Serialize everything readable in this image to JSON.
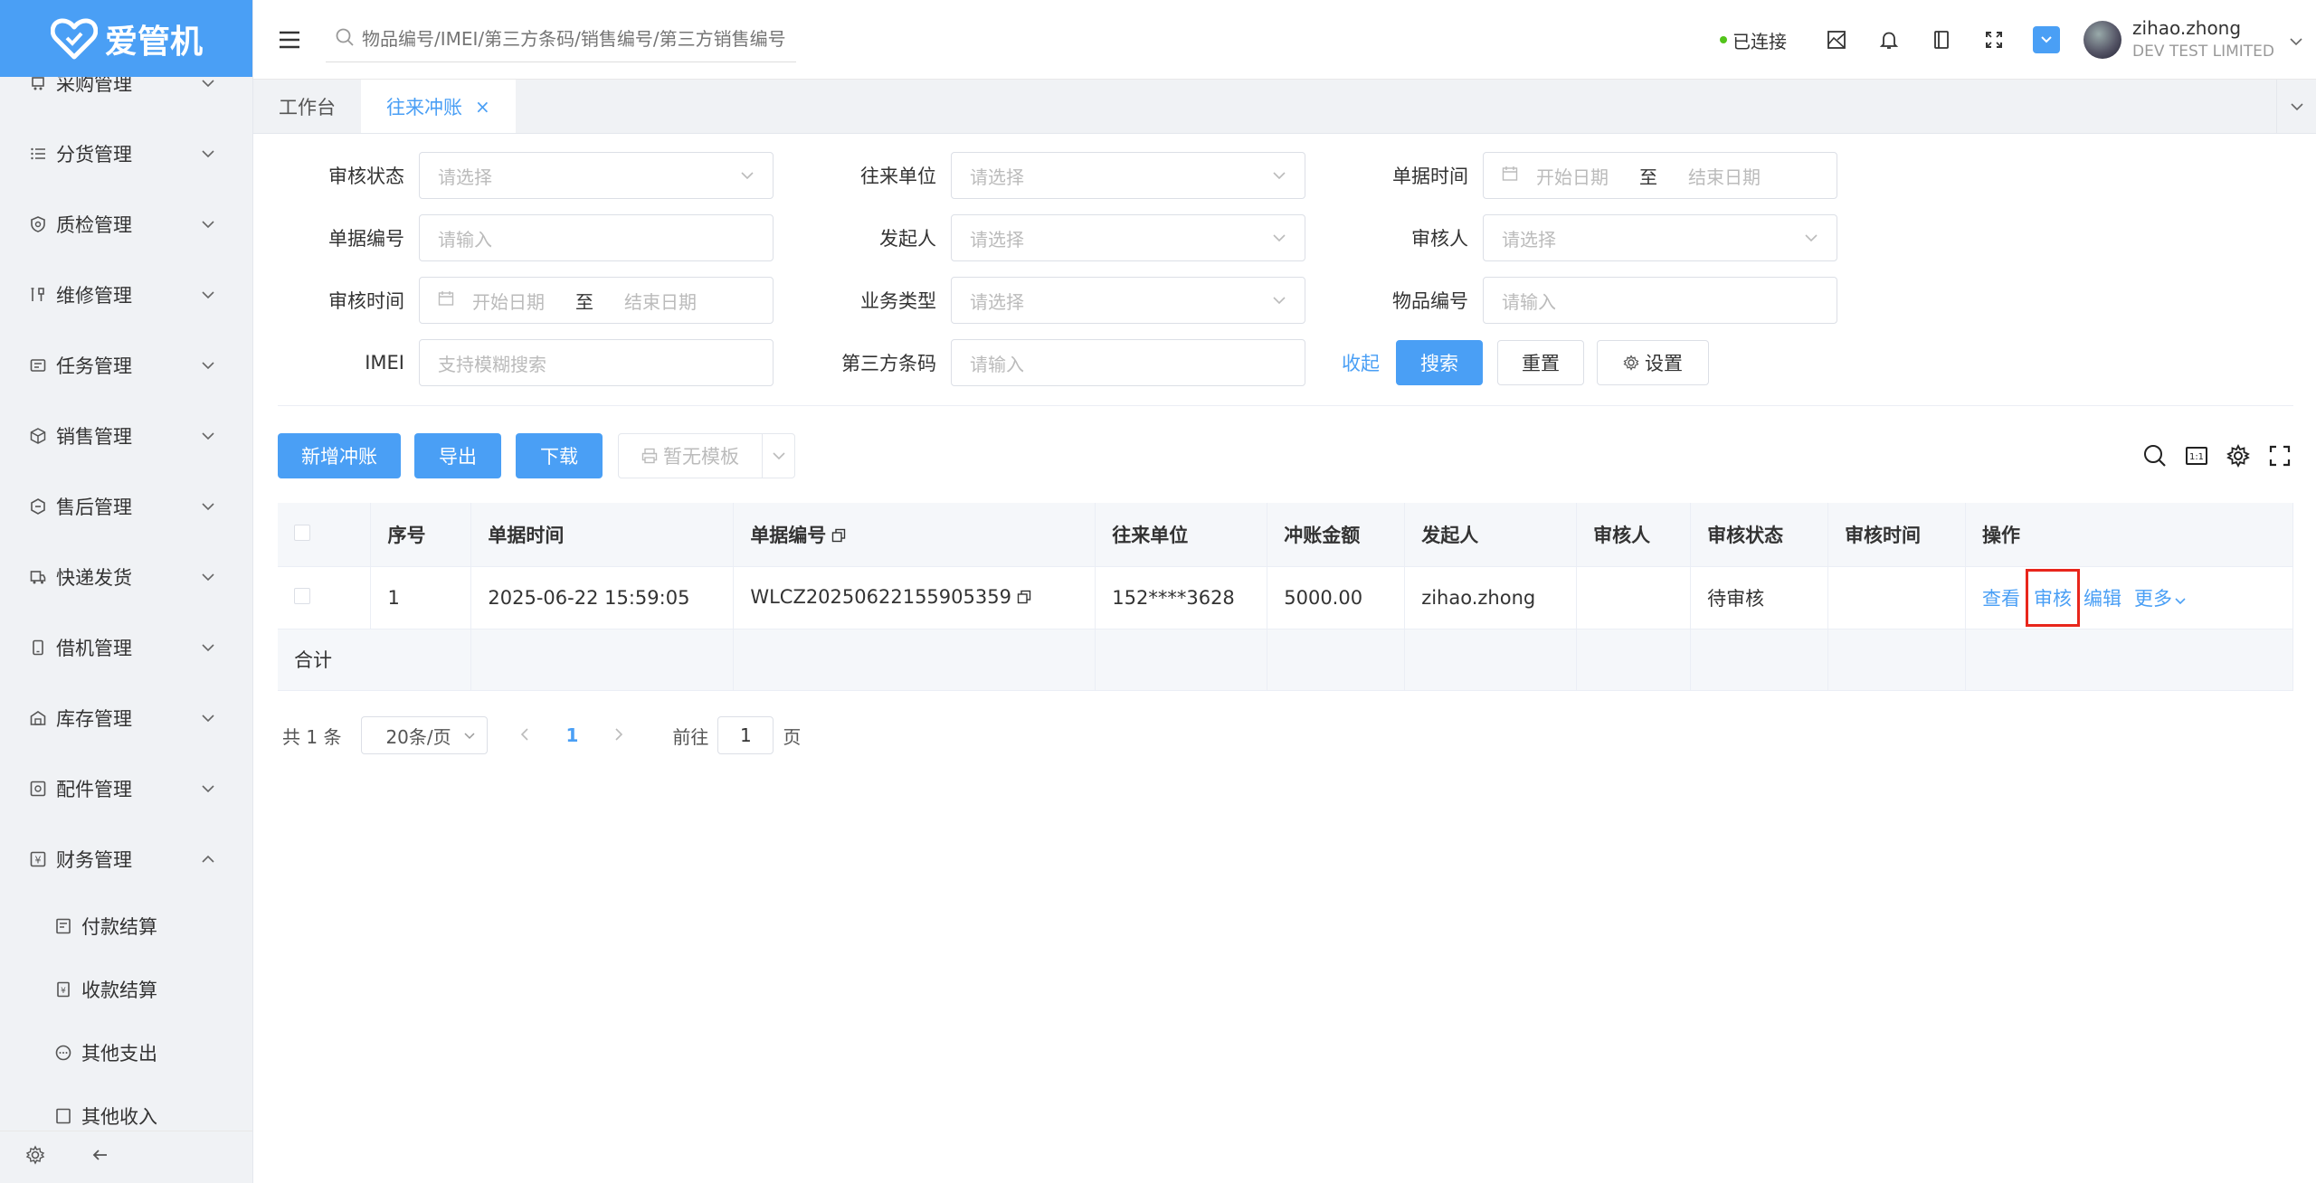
{
  "app": {
    "logo_text": "爱管机"
  },
  "sidebar": {
    "items": [
      {
        "label": "采购管理",
        "icon": "cart-icon"
      },
      {
        "label": "分货管理",
        "icon": "list-icon"
      },
      {
        "label": "质检管理",
        "icon": "shield-check-icon"
      },
      {
        "label": "维修管理",
        "icon": "tools-icon"
      },
      {
        "label": "任务管理",
        "icon": "task-icon"
      },
      {
        "label": "销售管理",
        "icon": "box-icon"
      },
      {
        "label": "售后管理",
        "icon": "service-icon"
      },
      {
        "label": "快递发货",
        "icon": "truck-icon"
      },
      {
        "label": "借机管理",
        "icon": "phone-icon"
      },
      {
        "label": "库存管理",
        "icon": "warehouse-icon"
      },
      {
        "label": "配件管理",
        "icon": "parts-icon"
      },
      {
        "label": "财务管理",
        "icon": "finance-icon"
      }
    ],
    "sub_items": [
      {
        "label": "付款结算"
      },
      {
        "label": "收款结算"
      },
      {
        "label": "其他支出"
      },
      {
        "label": "其他收入"
      }
    ]
  },
  "header": {
    "search_placeholder": "物品编号/IMEI/第三方条码/销售编号/第三方销售编号",
    "status": "已连接",
    "user_name": "zihao.zhong",
    "user_company": "DEV TEST LIMITED"
  },
  "tabs": [
    {
      "label": "工作台",
      "active": false
    },
    {
      "label": "往来冲账",
      "active": true
    }
  ],
  "form": {
    "labels": {
      "audit_status": "审核状态",
      "partner": "往来单位",
      "doc_time": "单据时间",
      "doc_no": "单据编号",
      "initiator": "发起人",
      "auditor": "审核人",
      "audit_time": "审核时间",
      "biz_type": "业务类型",
      "item_no": "物品编号",
      "imei": "IMEI",
      "third_code": "第三方条码"
    },
    "placeholders": {
      "select": "请选择",
      "input": "请输入",
      "fuzzy": "支持模糊搜索",
      "start_date": "开始日期",
      "end_date": "结束日期",
      "to": "至"
    },
    "collapse": "收起",
    "search": "搜索",
    "reset": "重置",
    "settings": "设置"
  },
  "toolbar": {
    "add": "新增冲账",
    "export": "导出",
    "download": "下载",
    "template": "暂无模板"
  },
  "table": {
    "columns": [
      "序号",
      "单据时间",
      "单据编号",
      "往来单位",
      "冲账金额",
      "发起人",
      "审核人",
      "审核状态",
      "审核时间",
      "操作"
    ],
    "rows": [
      {
        "idx": "1",
        "time": "2025-06-22 15:59:05",
        "no": "WLCZ20250622155905359",
        "partner": "152****3628",
        "amount": "5000.00",
        "initiator": "zihao.zhong",
        "auditor": "",
        "status": "待审核",
        "audit_time": ""
      }
    ],
    "actions": {
      "view": "查看",
      "audit": "审核",
      "edit": "编辑",
      "more": "更多"
    },
    "sum_label": "合计"
  },
  "pagination": {
    "total": "共 1 条",
    "page_size": "20条/页",
    "current": "1",
    "goto_prefix": "前往",
    "goto_value": "1",
    "goto_suffix": "页"
  },
  "colors": {
    "primary": "#4a9ff5",
    "highlight": "#e8261c",
    "connected": "#52c41a"
  }
}
